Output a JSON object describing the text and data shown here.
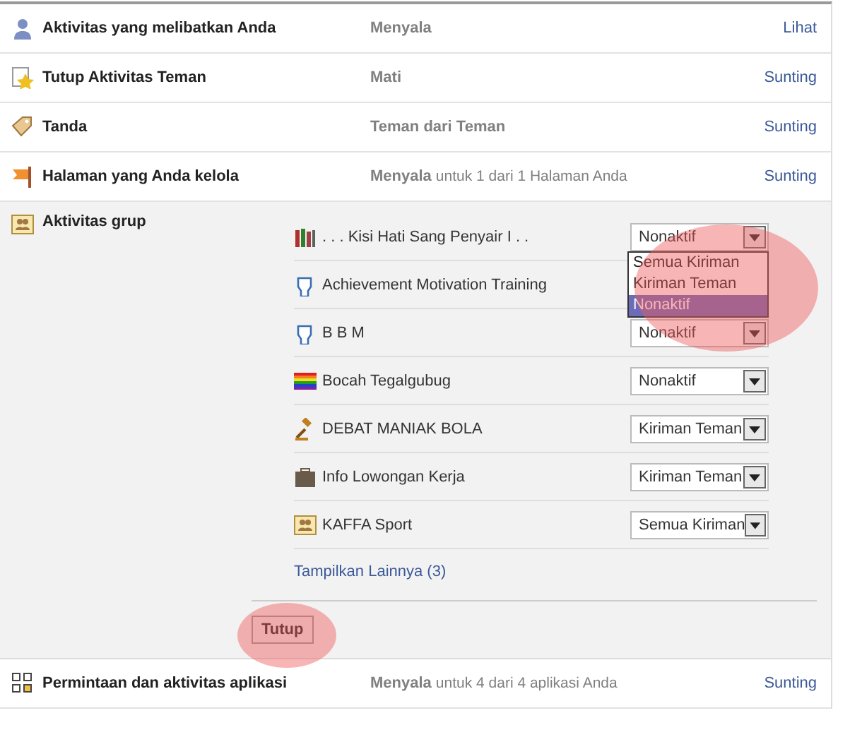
{
  "settings": [
    {
      "label": "Aktivitas yang melibatkan Anda",
      "status": "Menyala",
      "action": "Lihat"
    },
    {
      "label": "Tutup Aktivitas Teman",
      "status": "Mati",
      "action": "Sunting"
    },
    {
      "label": "Tanda",
      "status": "Teman dari Teman",
      "action": "Sunting"
    },
    {
      "label": "Halaman yang Anda kelola",
      "status": "Menyala",
      "detail": "untuk 1 dari 1 Halaman Anda",
      "action": "Sunting"
    }
  ],
  "group_section": {
    "label": "Aktivitas grup",
    "groups": [
      {
        "name": ". . . Kisi Hati Sang Penyair I . .",
        "value": "Nonaktif",
        "open": true,
        "options": [
          {
            "label": "Semua Kiriman",
            "selected": false
          },
          {
            "label": "Kiriman Teman",
            "selected": false
          },
          {
            "label": "Nonaktif",
            "selected": true
          }
        ]
      },
      {
        "name": "Achievement Motivation Training"
      },
      {
        "name": "B B M",
        "value": "Nonaktif"
      },
      {
        "name": "Bocah Tegalgubug",
        "value": "Nonaktif"
      },
      {
        "name": "DEBAT MANIAK BOLA",
        "value": "Kiriman Teman"
      },
      {
        "name": "Info Lowongan Kerja",
        "value": "Kiriman Teman"
      },
      {
        "name": "KAFFA Sport",
        "value": "Semua Kiriman"
      }
    ],
    "more_link": "Tampilkan Lainnya (3)",
    "close_button": "Tutup"
  },
  "footer_setting": {
    "label": "Permintaan dan aktivitas aplikasi",
    "status": "Menyala",
    "detail": "untuk 4 dari 4 aplikasi Anda",
    "action": "Sunting"
  }
}
